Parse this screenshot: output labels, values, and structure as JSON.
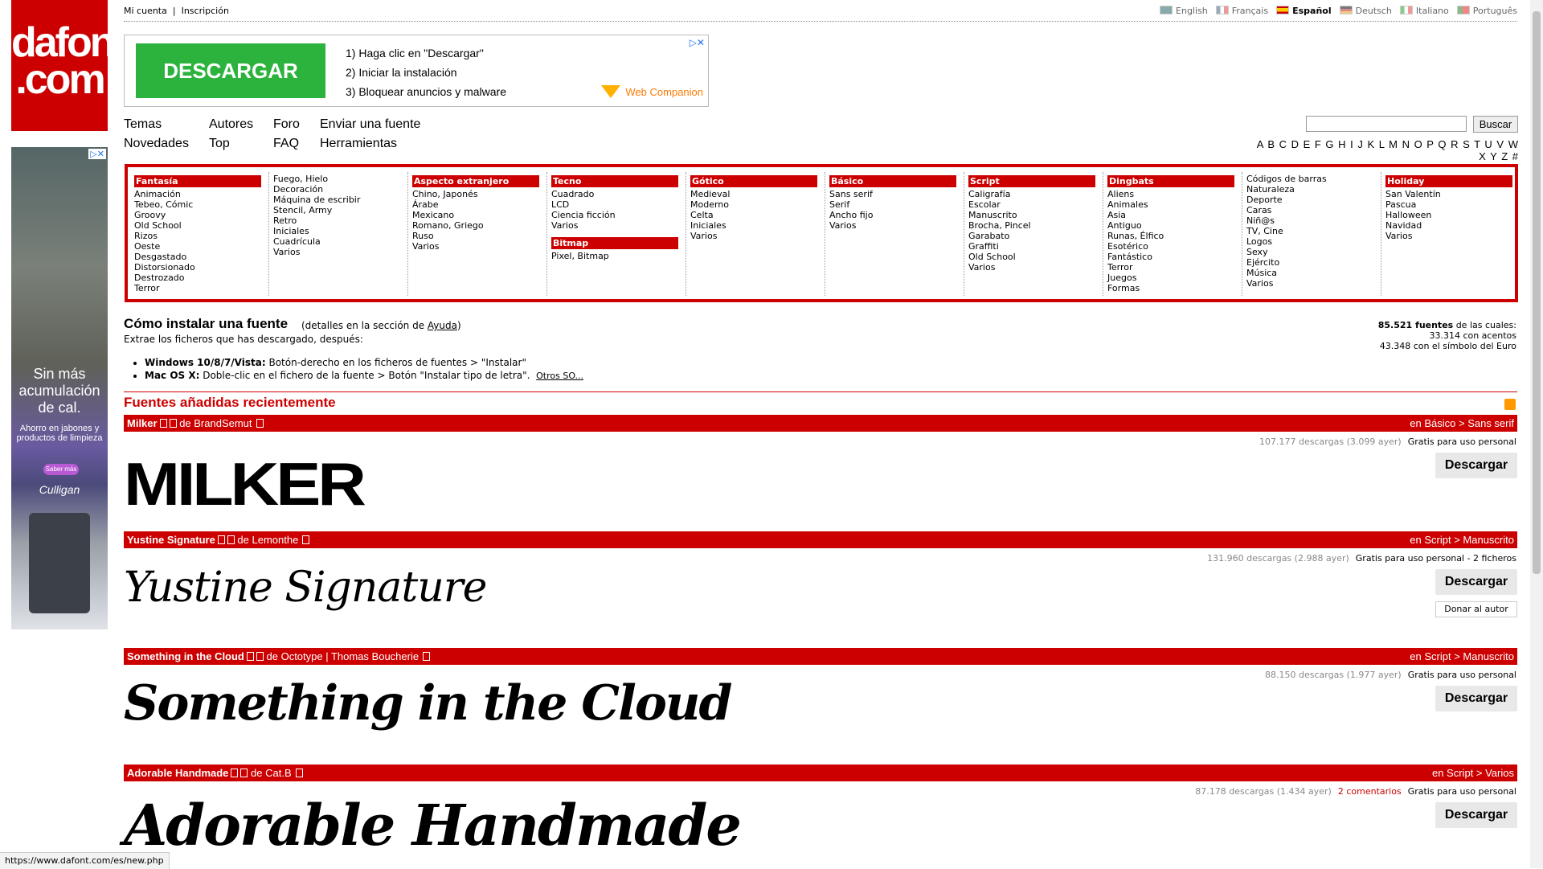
{
  "logo": "dafont .com",
  "topbar": {
    "my_account": "Mi cuenta",
    "sep": "|",
    "signup": "Inscripción",
    "languages": [
      "English",
      "Français",
      "Español",
      "Deutsch",
      "Italiano",
      "Português"
    ],
    "active_language": "Español"
  },
  "ad": {
    "button": "DESCARGAR",
    "steps": [
      "1) Haga clic en \"Descargar\"",
      "2) Iniciar la instalación",
      "3) Bloquear anuncios y malware"
    ],
    "brand": "Web Companion",
    "adchoices": "▷✕"
  },
  "nav": {
    "row1": [
      "Temas",
      "Autores",
      "Foro",
      "Enviar una fuente"
    ],
    "row2": [
      "Novedades",
      "Top",
      "FAQ",
      "Herramientas"
    ],
    "search_button": "Buscar",
    "alphabet": "A B C D E F G H I J K L M N O P Q R S T U V W X Y Z #"
  },
  "side_ad": {
    "headline": "Sin más acumulación de cal.",
    "sub": "Ahorro en jabones y productos de limpieza",
    "cta": "Saber más",
    "brand": "Culligan"
  },
  "categories": [
    {
      "groups": [
        {
          "title": "Fantasía",
          "items": [
            "Animación",
            "Tebeo, Cómic",
            "Groovy",
            "Old School",
            "Rizos",
            "Oeste",
            "Desgastado",
            "Distorsionado",
            "Destrozado",
            "Terror"
          ]
        }
      ]
    },
    {
      "groups": [
        {
          "title": "",
          "items": [
            "Fuego, Hielo",
            "Decoración",
            "Máquina de escribir",
            "Stencil, Army",
            "Retro",
            "Iniciales",
            "Cuadrícula",
            "Varios"
          ]
        }
      ]
    },
    {
      "groups": [
        {
          "title": "Aspecto extranjero",
          "items": [
            "Chino, Japonés",
            "Árabe",
            "Mexicano",
            "Romano, Griego",
            "Ruso",
            "Varios"
          ]
        }
      ]
    },
    {
      "groups": [
        {
          "title": "Tecno",
          "items": [
            "Cuadrado",
            "LCD",
            "Ciencia ficción",
            "Varios"
          ]
        },
        {
          "title": "Bitmap",
          "items": [
            "Pixel, Bitmap"
          ]
        }
      ]
    },
    {
      "groups": [
        {
          "title": "Gótico",
          "items": [
            "Medieval",
            "Moderno",
            "Celta",
            "Iniciales",
            "Varios"
          ]
        }
      ]
    },
    {
      "groups": [
        {
          "title": "Básico",
          "items": [
            "Sans serif",
            "Serif",
            "Ancho fijo",
            "Varios"
          ]
        }
      ]
    },
    {
      "groups": [
        {
          "title": "Script",
          "items": [
            "Caligrafía",
            "Escolar",
            "Manuscrito",
            "Brocha, Pincel",
            "Garabato",
            "Graffiti",
            "Old School",
            "Varios"
          ]
        }
      ]
    },
    {
      "groups": [
        {
          "title": "Dingbats",
          "items": [
            "Aliens",
            "Animales",
            "Asia",
            "Antiguo",
            "Runas, Élfico",
            "Esotérico",
            "Fantástico",
            "Terror",
            "Juegos",
            "Formas"
          ]
        }
      ]
    },
    {
      "groups": [
        {
          "title": "",
          "items": [
            "Códigos de barras",
            "Naturaleza",
            "Deporte",
            "Caras",
            "Niñ@s",
            "TV, Cine",
            "Logos",
            "Sexy",
            "Ejército",
            "Música",
            "Varios"
          ]
        }
      ]
    },
    {
      "groups": [
        {
          "title": "Holiday",
          "items": [
            "San Valentín",
            "Pascua",
            "Halloween",
            "Navidad",
            "Varios"
          ]
        }
      ]
    }
  ],
  "install": {
    "title": "Cómo instalar una fuente",
    "detail_pre": "(detalles en la sección de ",
    "detail_link": "Ayuda",
    "detail_post": ")",
    "sub": "Extrae los ficheros que has descargado, después:",
    "win_label": "Windows 10/8/7/Vista:",
    "win_text": " Botón-derecho en los ficheros de fuentes > \"Instalar\"",
    "mac_label": "Mac OS X:",
    "mac_text": " Doble-clic en el fichero de la fuente > Botón \"Instalar tipo de letra\".",
    "other": "Otros SO..."
  },
  "stats": {
    "count": "85.521 fuentes",
    "count_suffix": " de las cuales:",
    "accents": "33.314 con acentos",
    "euro": "43.348 con el símbolo del Euro"
  },
  "recent_title": "Fuentes añadidas recientemente",
  "fonts": [
    {
      "name": "Milker",
      "by": " de ",
      "author": "BrandSemut",
      "category": "en Básico > Sans serif",
      "downloads": "107.177 descargas (3.099 ayer)",
      "license": "Gratis para uso personal",
      "comments": "",
      "preview": "MILKER",
      "button": "Descargar",
      "donate": ""
    },
    {
      "name": "Yustine Signature",
      "by": " de ",
      "author": "Lemonthe",
      "category": "en Script > Manuscrito",
      "downloads": "131.960 descargas (2.988 ayer)",
      "license": "Gratis para uso personal - 2 ficheros",
      "comments": "",
      "preview": "Yustine Signature",
      "button": "Descargar",
      "donate": "Donar al autor"
    },
    {
      "name": "Something in the Cloud",
      "by": " de ",
      "author": "Octotype | Thomas Boucherie",
      "category": "en Script > Manuscrito",
      "downloads": "88.150 descargas (1.977 ayer)",
      "license": "Gratis para uso personal",
      "comments": "",
      "preview": "Something in the Cloud",
      "button": "Descargar",
      "donate": ""
    },
    {
      "name": "Adorable Handmade",
      "by": " de ",
      "author": "Cat.B",
      "category": "en Script > Varios",
      "downloads": "87.178 descargas (1.434 ayer)",
      "license": "Gratis para uso personal",
      "comments": "2 comentarios",
      "preview": "Adorable Handmade",
      "button": "Descargar",
      "donate": ""
    }
  ],
  "statusbar": "https://www.dafont.com/es/new.php"
}
